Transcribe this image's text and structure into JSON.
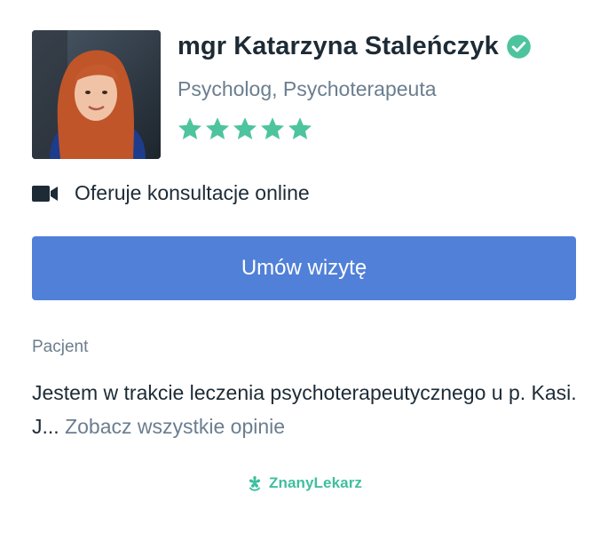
{
  "doctor": {
    "name": "mgr Katarzyna Staleńczyk",
    "specialty": "Psycholog, Psychoterapeuta",
    "rating": 5,
    "rating_max": 5,
    "verified": true
  },
  "online": {
    "label": "Oferuje konsultacje online",
    "icon": "video-camera-icon"
  },
  "booking": {
    "button_label": "Umów wizytę"
  },
  "review": {
    "author": "Pacjent",
    "text": "Jestem w trakcie leczenia psychoterapeutycznego u p. Kasi. J...",
    "link_label": "Zobacz wszystkie opinie"
  },
  "brand": {
    "name": "ZnanyLekarz",
    "icon": "znanylekarz-logo-icon"
  },
  "colors": {
    "accent_green": "#4dc49e",
    "button_blue": "#5180d8",
    "text_dark": "#1d2b36",
    "text_muted": "#6b7e8f"
  }
}
